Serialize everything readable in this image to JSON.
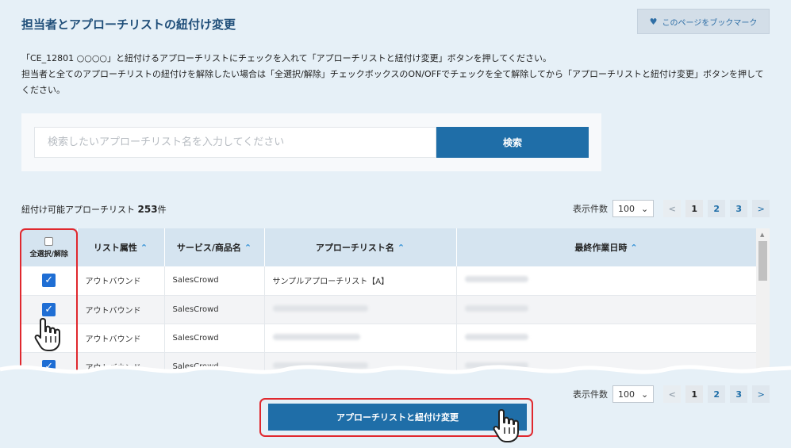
{
  "title": "担当者とアプローチリストの紐付け変更",
  "bookmark_label": "このページをブックマーク",
  "instructions": {
    "line1": "「CE_12801 ○○○○」と紐付けるアプローチリストにチェックを入れて「アプローチリストと紐付け変更」ボタンを押してください。",
    "line2": "担当者と全てのアプローチリストの紐付けを解除したい場合は「全選択/解除」チェックボックスのON/OFFでチェックを全て解除してから「アプローチリストと紐付け変更」ボタンを押してください。"
  },
  "search": {
    "placeholder": "検索したいアプローチリスト名を入力してください",
    "button": "検索"
  },
  "list_count": {
    "label": "紐付け可能アプローチリスト",
    "count": "253",
    "unit": "件"
  },
  "pager": {
    "label": "表示件数",
    "per_page": "100",
    "pages": [
      "1",
      "2",
      "3"
    ],
    "prev": "<",
    "next": ">"
  },
  "table": {
    "headers": {
      "select_all": "全選択/解除",
      "attribute": "リスト属性",
      "service": "サービス/商品名",
      "list_name": "アプローチリスト名",
      "last_updated": "最終作業日時"
    },
    "rows": [
      {
        "attribute": "アウトバウンド",
        "service": "SalesCrowd",
        "list_name": "サンプルアプローチリスト【A】",
        "checked": true
      },
      {
        "attribute": "アウトバウンド",
        "service": "SalesCrowd",
        "list_name": "",
        "checked": true
      },
      {
        "attribute": "アウトバウンド",
        "service": "SalesCrowd",
        "list_name": "",
        "checked": false
      },
      {
        "attribute": "アウトバウンド",
        "service": "SalesCrowd",
        "list_name": "",
        "checked": true
      }
    ]
  },
  "cta_label": "アプローチリストと紐付け変更",
  "colors": {
    "primary": "#1f6ea8",
    "highlight": "#e0282e",
    "checkbox": "#1f6ed4",
    "header_bg": "#d5e4f0",
    "page_bg": "#e6f0f7"
  }
}
